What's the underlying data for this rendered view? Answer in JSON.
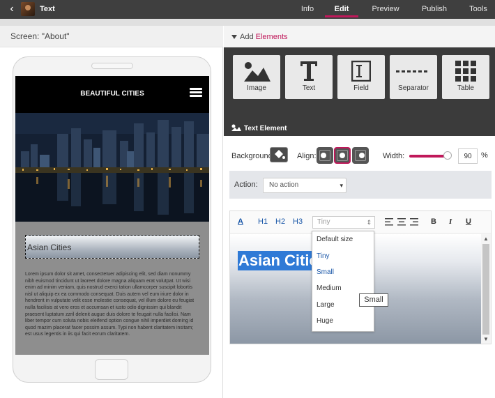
{
  "topbar": {
    "title": "Text",
    "nav": [
      {
        "label": "Info"
      },
      {
        "label": "Edit"
      },
      {
        "label": "Preview"
      },
      {
        "label": "Publish"
      },
      {
        "label": "Tools"
      }
    ],
    "active_tab": "Edit",
    "accent": "#c0185a"
  },
  "left": {
    "screen_label": "Screen: \"About\"",
    "phone": {
      "header_title": "BEAUTIFUL CITIES",
      "heading": "Asian Cities",
      "lorem": "Lorem ipsum dolor sit amet, consectetuer adipiscing elit, sed diam nonummy nibh euismod tincidunt ut laoreet dolore magna aliquam erat volutpat. Ut wisi enim ad minim veniam, quis nostrud exerci tation ullamcorper suscipit lobortis nisl ut aliquip ex ea commodo consequat. Duis autem vel eum iriure dolor in hendrerit in vulputate velit esse molestie consequat, vel illum dolore eu feugiat nulla facilisis at vero eros et accumsan et iusto odio dignissim qui blandit praesent luptatum zzril delenit augue duis dolore te feugait nulla facilisi. Nam liber tempor cum soluta nobis eleifend option congue nihil imperdiet doming id quod mazim placerat facer possim assum. Typi non habent claritatem insitam; est usus legentis in iis qui facit eorum claritatem."
    }
  },
  "right": {
    "add_prefix": "Add ",
    "add_highlight": "Elements",
    "tools": [
      {
        "label": "Image",
        "icon": "image-icon"
      },
      {
        "label": "Text",
        "icon": "text-icon"
      },
      {
        "label": "Field",
        "icon": "field-icon"
      },
      {
        "label": "Separator",
        "icon": "separator-icon"
      },
      {
        "label": "Table",
        "icon": "table-icon"
      }
    ],
    "section_title": "Text Element",
    "props": {
      "background_label": "Background:",
      "align_label": "Align:",
      "align_selected": "center",
      "width_label": "Width:",
      "width_value": "90",
      "width_unit": "%"
    },
    "action": {
      "label": "Action:",
      "value": "No action"
    },
    "editor": {
      "toolbar": {
        "color": "A",
        "h1": "H1",
        "h2": "H2",
        "h3": "H3",
        "size_value": "Tiny",
        "bold": "B",
        "italic": "I",
        "underline": "U"
      },
      "content": "Asian Citie"
    },
    "size_dropdown": {
      "options": [
        "Default size",
        "Tiny",
        "Small",
        "Medium",
        "Large",
        "Huge"
      ]
    },
    "tooltip": "Small"
  }
}
